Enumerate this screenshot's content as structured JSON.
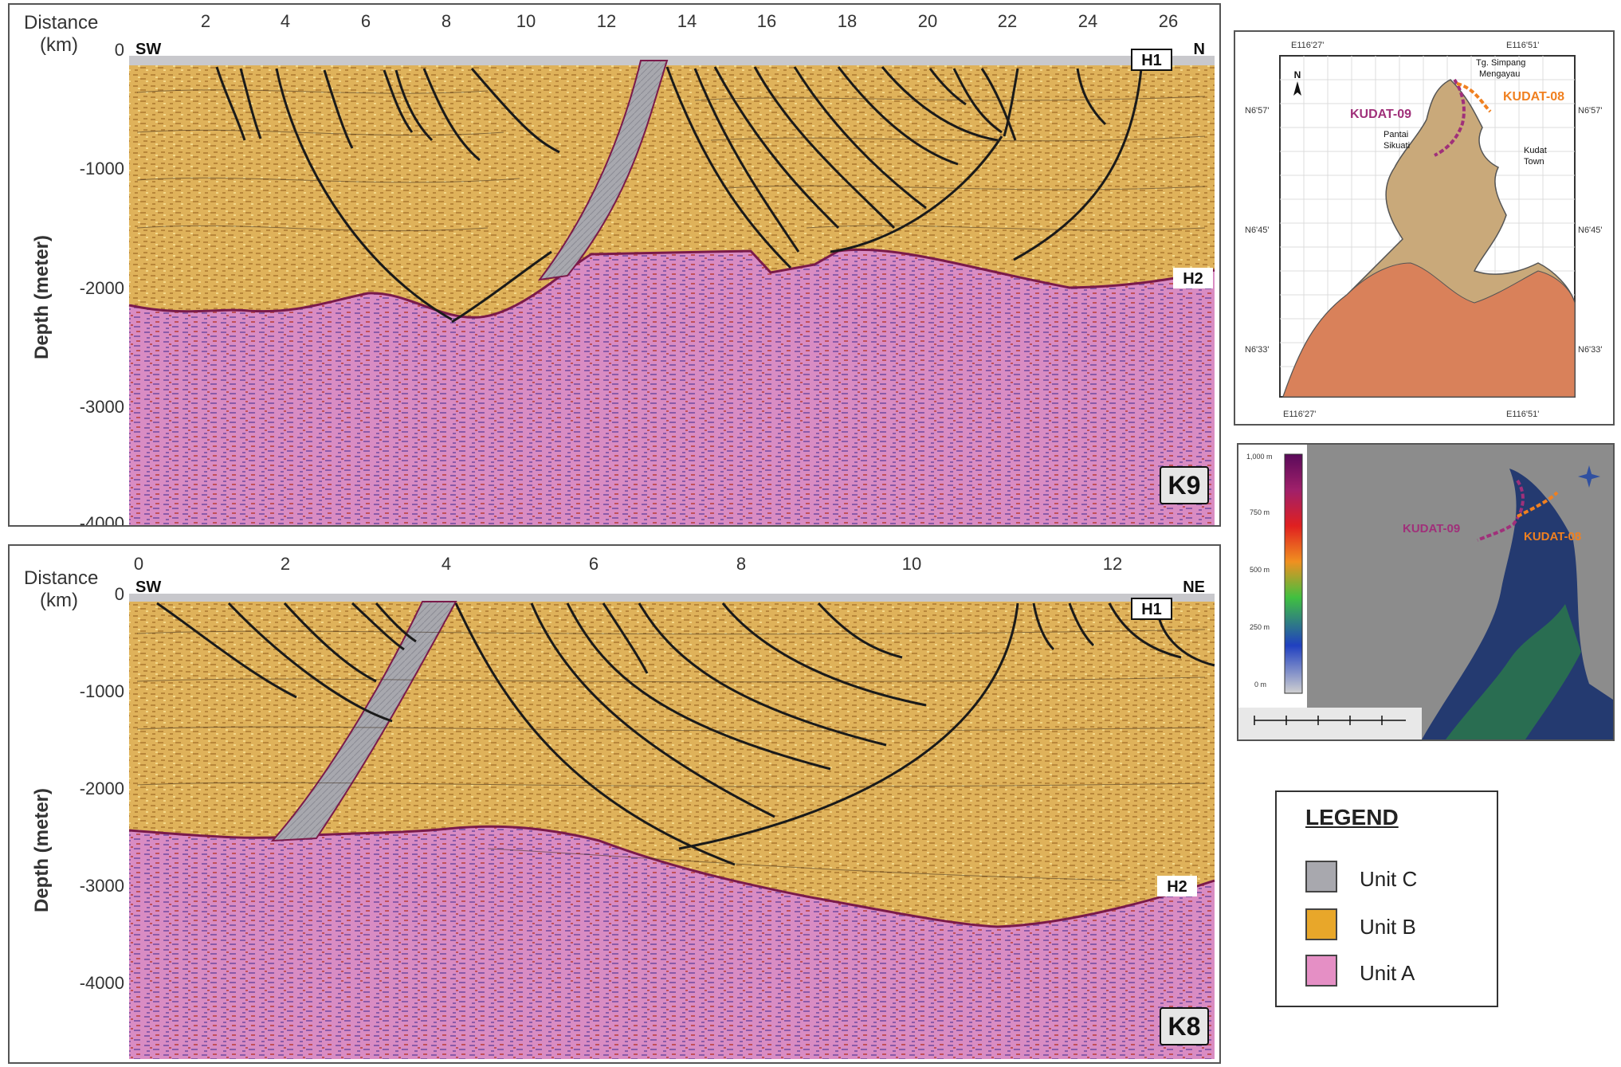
{
  "k9": {
    "distance_label": "Distance",
    "distance_unit": "(km)",
    "depth_label": "Depth (meter)",
    "x_ticks": [
      "2",
      "4",
      "6",
      "8",
      "10",
      "12",
      "14",
      "16",
      "18",
      "20",
      "22",
      "24",
      "26"
    ],
    "y_ticks": [
      "0",
      "-1000",
      "-2000",
      "-3000",
      "-4000"
    ],
    "dir_left": "SW",
    "dir_right": "N",
    "h1": "H1",
    "h2": "H2",
    "name": "K9"
  },
  "k8": {
    "distance_label": "Distance",
    "distance_unit": "(km)",
    "depth_label": "Depth (meter)",
    "x_ticks": [
      "0",
      "2",
      "4",
      "6",
      "8",
      "10",
      "12"
    ],
    "y_ticks": [
      "0",
      "-1000",
      "-2000",
      "-3000",
      "-4000"
    ],
    "dir_left": "SW",
    "dir_right": "NE",
    "h1": "H1",
    "h2": "H2",
    "name": "K8"
  },
  "location_map": {
    "coord_top_left": "E116'27'",
    "coord_top_right": "E116'51'",
    "coord_bottom_left": "E116'27'",
    "coord_bottom_right": "E116'51'",
    "lat_57_left": "N6'57'",
    "lat_57_right": "N6'57'",
    "lat_45_left": "N6'45'",
    "lat_45_right": "N6'45'",
    "lat_33_left": "N6'33'",
    "lat_33_right": "N6'33'",
    "north": "N",
    "kudat09": "KUDAT-09",
    "kudat08": "KUDAT-08",
    "place_simpang": "Tg. Simpang",
    "place_mengayau": "Mengayau",
    "place_pantai": "Pantai",
    "place_sikuati": "Sikuati",
    "place_kudat": "Kudat",
    "place_town": "Town"
  },
  "dem_map": {
    "scale_top": "1,000 m",
    "scale_750": "750 m",
    "scale_500": "500 m",
    "scale_250": "250 m",
    "scale_0": "0 m",
    "kudat09": "KUDAT-09",
    "kudat08": "KUDAT-08"
  },
  "legend": {
    "title": "LEGEND",
    "items": [
      {
        "label": "Unit C",
        "color": "#a8a8ae"
      },
      {
        "label": "Unit B",
        "color": "#e8a72a"
      },
      {
        "label": "Unit A",
        "color": "#e58fc5"
      }
    ]
  },
  "colors": {
    "unit_a": "#d98cc3",
    "unit_b": "#dfb25a",
    "unit_c": "#a8a8ae",
    "horizon": "#7a1a4a",
    "land": "#c9a97a",
    "land_south": "#d9815a"
  }
}
